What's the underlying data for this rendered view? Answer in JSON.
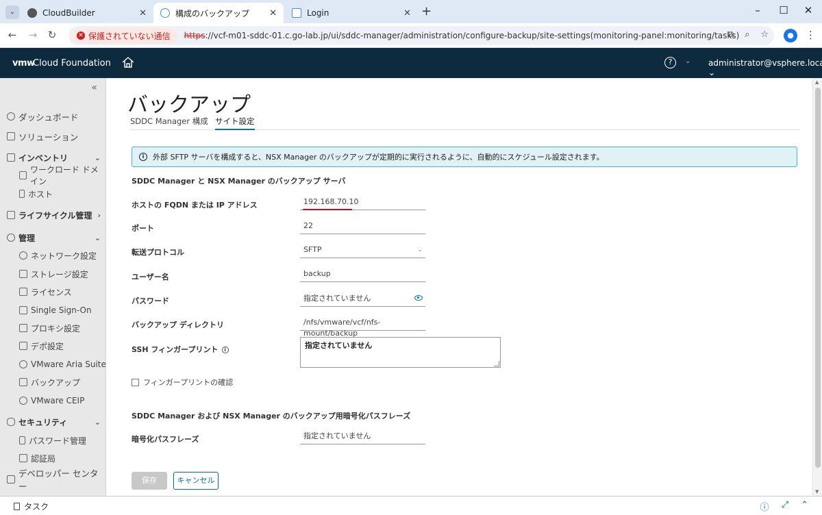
{
  "browser": {
    "tabs": [
      {
        "label": "CloudBuilder",
        "active": false
      },
      {
        "label": "構成のバックアップ",
        "active": true
      },
      {
        "label": "Login",
        "active": false
      }
    ],
    "insecure_label": "保護されていない通信",
    "url_scheme": "https",
    "url_rest": "://vcf-m01-sddc-01.c.go-lab.jp/ui/sddc-manager/administration/configure-backup/site-settings(monitoring-panel:monitoring/tasks)"
  },
  "header": {
    "logo": "vmw",
    "product": "Cloud Foundation",
    "help": "?",
    "user": "administrator@vsphere.local"
  },
  "sidebar": {
    "collapse": "«",
    "items": [
      {
        "label": "ダッシュボード",
        "icon": "dashboard-icon"
      },
      {
        "label": "ソリューション",
        "icon": "solutions-icon"
      },
      {
        "label": "インベントリ",
        "icon": "inventory-icon"
      },
      {
        "label": "ワークロード ドメイン",
        "icon": "workload-domain-icon"
      },
      {
        "label": "ホスト",
        "icon": "host-icon"
      },
      {
        "label": "ライフサイクル管理",
        "icon": "lifecycle-icon"
      },
      {
        "label": "管理",
        "icon": "admin-gear-icon"
      },
      {
        "label": "ネットワーク設定",
        "icon": "network-icon"
      },
      {
        "label": "ストレージ設定",
        "icon": "storage-icon"
      },
      {
        "label": "ライセンス",
        "icon": "license-icon"
      },
      {
        "label": "Single Sign-On",
        "icon": "sso-icon"
      },
      {
        "label": "プロキシ設定",
        "icon": "proxy-icon"
      },
      {
        "label": "デポ設定",
        "icon": "depot-icon"
      },
      {
        "label": "VMware Aria Suite",
        "icon": "aria-icon"
      },
      {
        "label": "バックアップ",
        "icon": "backup-icon"
      },
      {
        "label": "VMware CEIP",
        "icon": "ceip-icon"
      },
      {
        "label": "セキュリティ",
        "icon": "security-shield-icon"
      },
      {
        "label": "パスワード管理",
        "icon": "lock-icon"
      },
      {
        "label": "認証局",
        "icon": "certificate-icon"
      },
      {
        "label": "デベロッパー センター",
        "icon": "developer-icon"
      }
    ]
  },
  "page": {
    "title": "バックアップ",
    "tabs": [
      "SDDC Manager 構成",
      "サイト設定"
    ],
    "info": "外部 SFTP サーバを構成すると、NSX Manager のバックアップが定期的に実行されるように、自動的にスケジュール設定されます。",
    "section1": "SDDC Manager と NSX Manager のバックアップ サーバ",
    "fields": {
      "host_label": "ホストの FQDN または IP アドレス",
      "host_value": "192.168.70.10",
      "port_label": "ポート",
      "port_value": "22",
      "protocol_label": "転送プロトコル",
      "protocol_value": "SFTP",
      "user_label": "ユーザー名",
      "user_value": "backup",
      "password_label": "パスワード",
      "password_value": "指定されていません",
      "dir_label": "バックアップ ディレクトリ",
      "dir_value": "/nfs/vmware/vcf/nfs-mount/backup",
      "ssh_label": "SSH フィンガープリント",
      "ssh_value": "指定されていません",
      "confirm_label": "フィンガープリントの確認"
    },
    "section2": "SDDC Manager および NSX Manager のバックアップ用暗号化パスフレーズ",
    "passphrase_label": "暗号化パスフレーズ",
    "passphrase_value": "指定されていません",
    "save_label": "保存",
    "cancel_label": "キャンセル"
  },
  "taskbar": {
    "label": "タスク"
  }
}
